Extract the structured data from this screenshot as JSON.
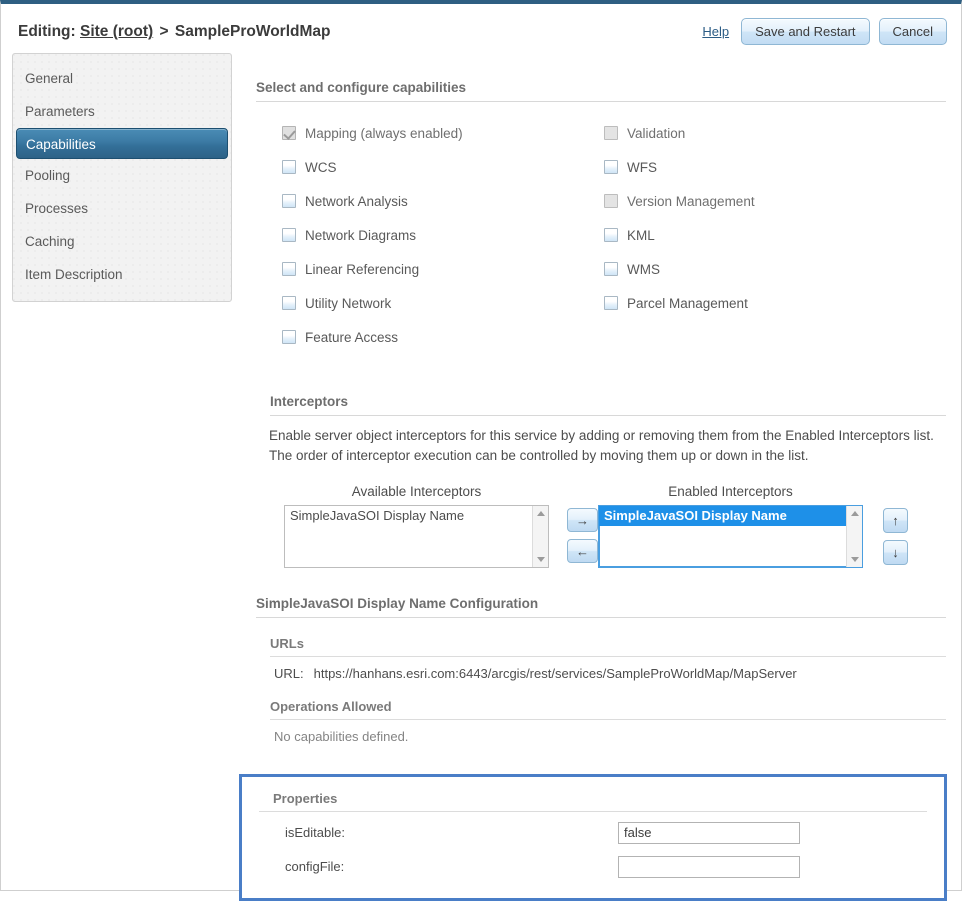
{
  "header": {
    "editing_label": "Editing:",
    "breadcrumb_root": "Site (root)",
    "breadcrumb_separator": ">",
    "breadcrumb_current": "SampleProWorldMap",
    "help_label": "Help",
    "save_label": "Save and Restart",
    "cancel_label": "Cancel"
  },
  "sidebar": {
    "items": [
      {
        "label": "General",
        "active": false
      },
      {
        "label": "Parameters",
        "active": false
      },
      {
        "label": "Capabilities",
        "active": true
      },
      {
        "label": "Pooling",
        "active": false
      },
      {
        "label": "Processes",
        "active": false
      },
      {
        "label": "Caching",
        "active": false
      },
      {
        "label": "Item Description",
        "active": false
      }
    ]
  },
  "capabilities": {
    "section_title": "Select and configure capabilities",
    "left_column": [
      {
        "label": "Mapping (always enabled)",
        "state": "checked-disabled"
      },
      {
        "label": "WCS",
        "state": "unchecked"
      },
      {
        "label": "Network Analysis",
        "state": "unchecked"
      },
      {
        "label": "Network Diagrams",
        "state": "unchecked"
      },
      {
        "label": "Linear Referencing",
        "state": "unchecked"
      },
      {
        "label": "Utility Network",
        "state": "unchecked"
      },
      {
        "label": "Feature Access",
        "state": "unchecked"
      }
    ],
    "right_column": [
      {
        "label": "Validation",
        "state": "disabled"
      },
      {
        "label": "WFS",
        "state": "unchecked"
      },
      {
        "label": "Version Management",
        "state": "disabled"
      },
      {
        "label": "KML",
        "state": "unchecked"
      },
      {
        "label": "WMS",
        "state": "unchecked"
      },
      {
        "label": "Parcel Management",
        "state": "unchecked"
      }
    ]
  },
  "interceptors": {
    "section_title": "Interceptors",
    "description": "Enable server object interceptors for this service by adding or removing them from the Enabled Interceptors list. The order of interceptor execution can be controlled by moving them up or down in the list.",
    "available_caption": "Available Interceptors",
    "enabled_caption": "Enabled Interceptors",
    "available_items": [
      "SimpleJavaSOI Display Name"
    ],
    "enabled_items": [
      "SimpleJavaSOI Display Name"
    ],
    "selected_enabled_index": 0,
    "add_button": "→",
    "remove_button": "←",
    "move_up_button": "↑",
    "move_down_button": "↓"
  },
  "configuration": {
    "section_title": "SimpleJavaSOI Display Name Configuration",
    "urls": {
      "heading": "URLs",
      "label": "URL:",
      "value": "https://hanhans.esri.com:6443/arcgis/rest/services/SampleProWorldMap/MapServer"
    },
    "operations": {
      "heading": "Operations Allowed",
      "text": "No capabilities defined."
    },
    "properties": {
      "heading": "Properties",
      "highlight_color": "#4a7ec7",
      "rows": [
        {
          "label": "isEditable:",
          "value": "false",
          "placeholder": ""
        },
        {
          "label": "configFile:",
          "value": "",
          "placeholder": ""
        }
      ]
    }
  }
}
